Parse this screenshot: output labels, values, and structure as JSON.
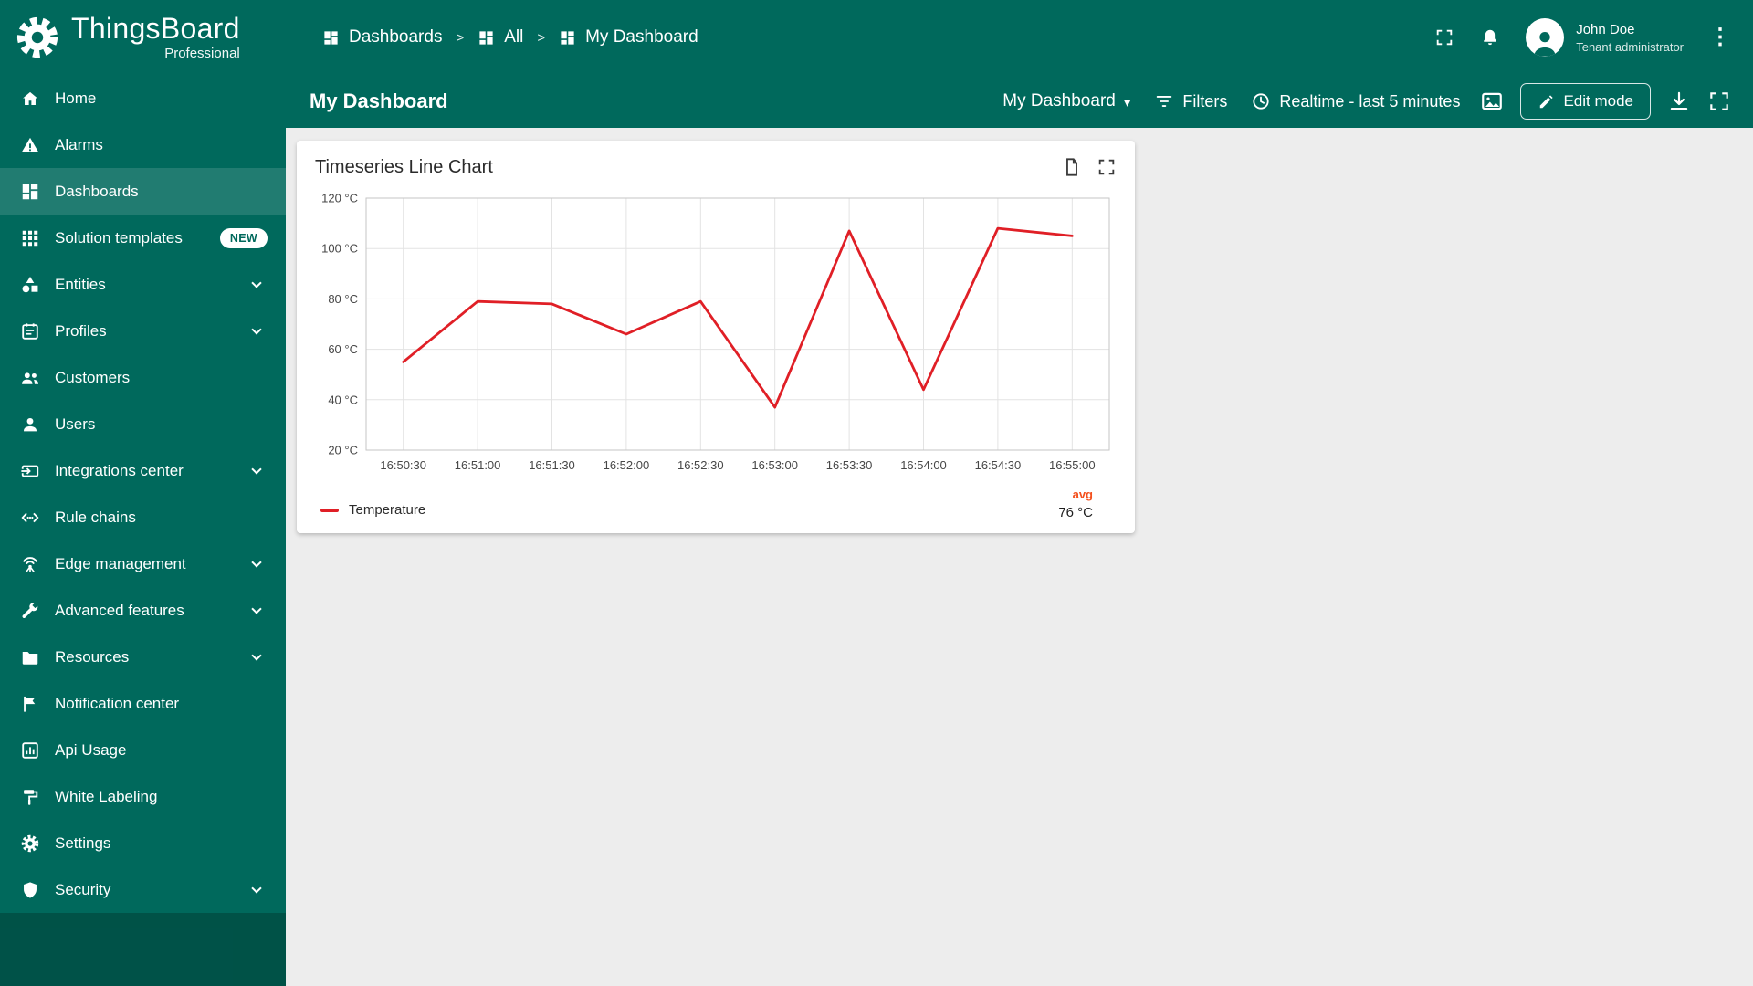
{
  "app": {
    "name": "ThingsBoard",
    "edition": "Professional"
  },
  "colors": {
    "primary": "#00695c",
    "content_background": "#ededed",
    "series_line": "#e01f26",
    "aggregation_accent": "#f4511e"
  },
  "sidebar": {
    "items": [
      {
        "label": "Home"
      },
      {
        "label": "Alarms"
      },
      {
        "label": "Dashboards",
        "active": true
      },
      {
        "label": "Solution templates",
        "badge": "NEW"
      },
      {
        "label": "Entities",
        "expandable": true
      },
      {
        "label": "Profiles",
        "expandable": true
      },
      {
        "label": "Customers"
      },
      {
        "label": "Users"
      },
      {
        "label": "Integrations center",
        "expandable": true
      },
      {
        "label": "Rule chains"
      },
      {
        "label": "Edge management",
        "expandable": true
      },
      {
        "label": "Advanced features",
        "expandable": true
      },
      {
        "label": "Resources",
        "expandable": true
      },
      {
        "label": "Notification center"
      },
      {
        "label": "Api Usage"
      },
      {
        "label": "White Labeling"
      },
      {
        "label": "Settings"
      },
      {
        "label": "Security",
        "expandable": true
      }
    ]
  },
  "breadcrumb": {
    "separator": ">",
    "items": [
      {
        "label": "Dashboards"
      },
      {
        "label": "All"
      },
      {
        "label": "My Dashboard"
      }
    ]
  },
  "header": {
    "user_name": "John Doe",
    "user_role": "Tenant administrator"
  },
  "toolbar": {
    "title": "My Dashboard",
    "dashboard_select": "My Dashboard",
    "filters": "Filters",
    "timewindow": "Realtime - last 5 minutes",
    "edit_mode": "Edit mode"
  },
  "widget": {
    "title": "Timeseries Line Chart"
  },
  "chart_data": {
    "type": "line",
    "title": "Timeseries Line Chart",
    "x": [
      "16:50:30",
      "16:51:00",
      "16:51:30",
      "16:52:00",
      "16:52:30",
      "16:53:00",
      "16:53:30",
      "16:54:00",
      "16:54:30",
      "16:55:00"
    ],
    "series": [
      {
        "name": "Temperature",
        "color": "#e01f26",
        "values": [
          55,
          79,
          78,
          66,
          79,
          37,
          107,
          44,
          108,
          105
        ]
      }
    ],
    "unit": "°C",
    "ylim": [
      20,
      120
    ],
    "yticks": [
      20,
      40,
      60,
      80,
      100,
      120
    ],
    "grid": true,
    "legend": {
      "position": "bottom",
      "agg_label": "avg",
      "agg_value": "76 °C"
    }
  }
}
